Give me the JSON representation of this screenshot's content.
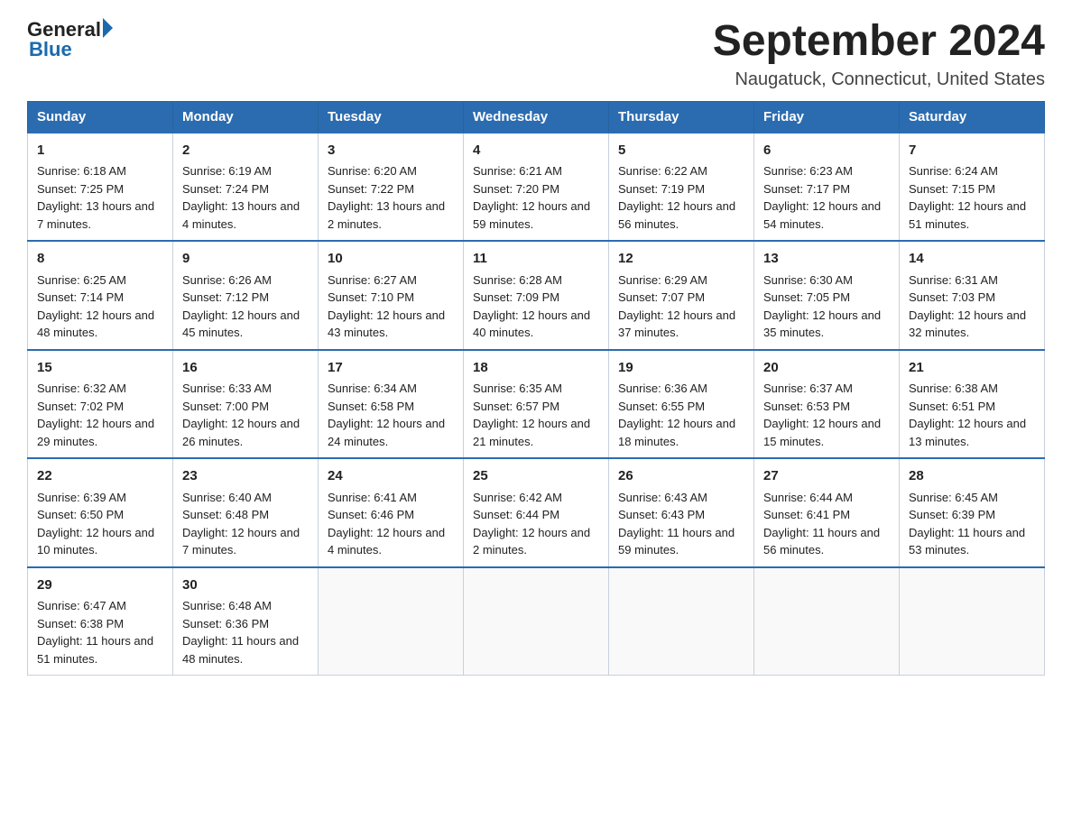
{
  "header": {
    "logo_general": "General",
    "logo_blue": "Blue",
    "month_title": "September 2024",
    "location": "Naugatuck, Connecticut, United States"
  },
  "days_of_week": [
    "Sunday",
    "Monday",
    "Tuesday",
    "Wednesday",
    "Thursday",
    "Friday",
    "Saturday"
  ],
  "weeks": [
    [
      {
        "day": "1",
        "sunrise": "6:18 AM",
        "sunset": "7:25 PM",
        "daylight": "13 hours and 7 minutes."
      },
      {
        "day": "2",
        "sunrise": "6:19 AM",
        "sunset": "7:24 PM",
        "daylight": "13 hours and 4 minutes."
      },
      {
        "day": "3",
        "sunrise": "6:20 AM",
        "sunset": "7:22 PM",
        "daylight": "13 hours and 2 minutes."
      },
      {
        "day": "4",
        "sunrise": "6:21 AM",
        "sunset": "7:20 PM",
        "daylight": "12 hours and 59 minutes."
      },
      {
        "day": "5",
        "sunrise": "6:22 AM",
        "sunset": "7:19 PM",
        "daylight": "12 hours and 56 minutes."
      },
      {
        "day": "6",
        "sunrise": "6:23 AM",
        "sunset": "7:17 PM",
        "daylight": "12 hours and 54 minutes."
      },
      {
        "day": "7",
        "sunrise": "6:24 AM",
        "sunset": "7:15 PM",
        "daylight": "12 hours and 51 minutes."
      }
    ],
    [
      {
        "day": "8",
        "sunrise": "6:25 AM",
        "sunset": "7:14 PM",
        "daylight": "12 hours and 48 minutes."
      },
      {
        "day": "9",
        "sunrise": "6:26 AM",
        "sunset": "7:12 PM",
        "daylight": "12 hours and 45 minutes."
      },
      {
        "day": "10",
        "sunrise": "6:27 AM",
        "sunset": "7:10 PM",
        "daylight": "12 hours and 43 minutes."
      },
      {
        "day": "11",
        "sunrise": "6:28 AM",
        "sunset": "7:09 PM",
        "daylight": "12 hours and 40 minutes."
      },
      {
        "day": "12",
        "sunrise": "6:29 AM",
        "sunset": "7:07 PM",
        "daylight": "12 hours and 37 minutes."
      },
      {
        "day": "13",
        "sunrise": "6:30 AM",
        "sunset": "7:05 PM",
        "daylight": "12 hours and 35 minutes."
      },
      {
        "day": "14",
        "sunrise": "6:31 AM",
        "sunset": "7:03 PM",
        "daylight": "12 hours and 32 minutes."
      }
    ],
    [
      {
        "day": "15",
        "sunrise": "6:32 AM",
        "sunset": "7:02 PM",
        "daylight": "12 hours and 29 minutes."
      },
      {
        "day": "16",
        "sunrise": "6:33 AM",
        "sunset": "7:00 PM",
        "daylight": "12 hours and 26 minutes."
      },
      {
        "day": "17",
        "sunrise": "6:34 AM",
        "sunset": "6:58 PM",
        "daylight": "12 hours and 24 minutes."
      },
      {
        "day": "18",
        "sunrise": "6:35 AM",
        "sunset": "6:57 PM",
        "daylight": "12 hours and 21 minutes."
      },
      {
        "day": "19",
        "sunrise": "6:36 AM",
        "sunset": "6:55 PM",
        "daylight": "12 hours and 18 minutes."
      },
      {
        "day": "20",
        "sunrise": "6:37 AM",
        "sunset": "6:53 PM",
        "daylight": "12 hours and 15 minutes."
      },
      {
        "day": "21",
        "sunrise": "6:38 AM",
        "sunset": "6:51 PM",
        "daylight": "12 hours and 13 minutes."
      }
    ],
    [
      {
        "day": "22",
        "sunrise": "6:39 AM",
        "sunset": "6:50 PM",
        "daylight": "12 hours and 10 minutes."
      },
      {
        "day": "23",
        "sunrise": "6:40 AM",
        "sunset": "6:48 PM",
        "daylight": "12 hours and 7 minutes."
      },
      {
        "day": "24",
        "sunrise": "6:41 AM",
        "sunset": "6:46 PM",
        "daylight": "12 hours and 4 minutes."
      },
      {
        "day": "25",
        "sunrise": "6:42 AM",
        "sunset": "6:44 PM",
        "daylight": "12 hours and 2 minutes."
      },
      {
        "day": "26",
        "sunrise": "6:43 AM",
        "sunset": "6:43 PM",
        "daylight": "11 hours and 59 minutes."
      },
      {
        "day": "27",
        "sunrise": "6:44 AM",
        "sunset": "6:41 PM",
        "daylight": "11 hours and 56 minutes."
      },
      {
        "day": "28",
        "sunrise": "6:45 AM",
        "sunset": "6:39 PM",
        "daylight": "11 hours and 53 minutes."
      }
    ],
    [
      {
        "day": "29",
        "sunrise": "6:47 AM",
        "sunset": "6:38 PM",
        "daylight": "11 hours and 51 minutes."
      },
      {
        "day": "30",
        "sunrise": "6:48 AM",
        "sunset": "6:36 PM",
        "daylight": "11 hours and 48 minutes."
      },
      null,
      null,
      null,
      null,
      null
    ]
  ],
  "labels": {
    "sunrise_prefix": "Sunrise: ",
    "sunset_prefix": "Sunset: ",
    "daylight_prefix": "Daylight: "
  }
}
